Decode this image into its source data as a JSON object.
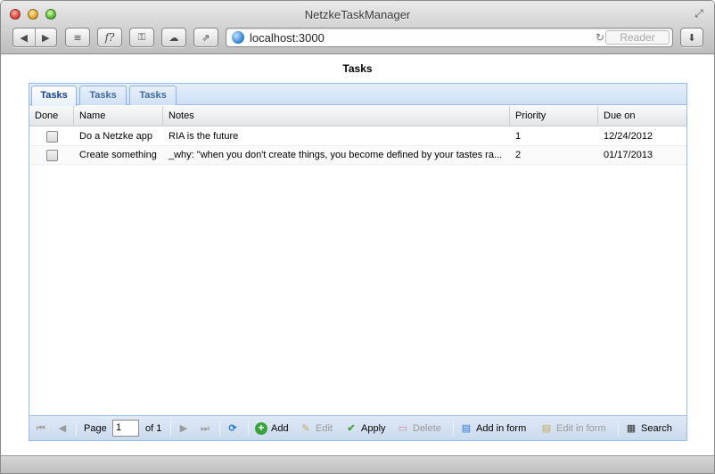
{
  "window": {
    "title": "NetzkeTaskManager"
  },
  "browser": {
    "url": "localhost:3000",
    "reader_label": "Reader",
    "icons": [
      "back-icon",
      "forward-icon",
      "rss-icon",
      "function-icon",
      "key-icon",
      "cloud-icon",
      "share-icon",
      "reload-icon",
      "download-icon",
      "fullscreen-icon"
    ]
  },
  "page": {
    "title": "Tasks",
    "tabs": [
      {
        "label": "Tasks",
        "active": true
      },
      {
        "label": "Tasks",
        "active": false
      },
      {
        "label": "Tasks",
        "active": false
      }
    ],
    "grid": {
      "columns": [
        "Done",
        "Name",
        "Notes",
        "Priority",
        "Due on"
      ],
      "rows": [
        {
          "done": false,
          "name": "Do a Netzke app",
          "notes": "RIA is the future",
          "priority": "1",
          "due_on": "12/24/2012"
        },
        {
          "done": false,
          "name": "Create something",
          "notes": "_why: \"when you don't create things, you become defined by your tastes ra...",
          "priority": "2",
          "due_on": "01/17/2013"
        }
      ]
    },
    "toolbar": {
      "page_label": "Page",
      "page_value": "1",
      "of_label": "of 1",
      "add_label": "Add",
      "edit_label": "Edit",
      "apply_label": "Apply",
      "delete_label": "Delete",
      "add_in_form_label": "Add in form",
      "edit_in_form_label": "Edit in form",
      "search_label": "Search"
    }
  },
  "colors": {
    "panel_border": "#99bbe8",
    "tab_text": "#15428b",
    "toolbar_bg": "#cadaee"
  }
}
